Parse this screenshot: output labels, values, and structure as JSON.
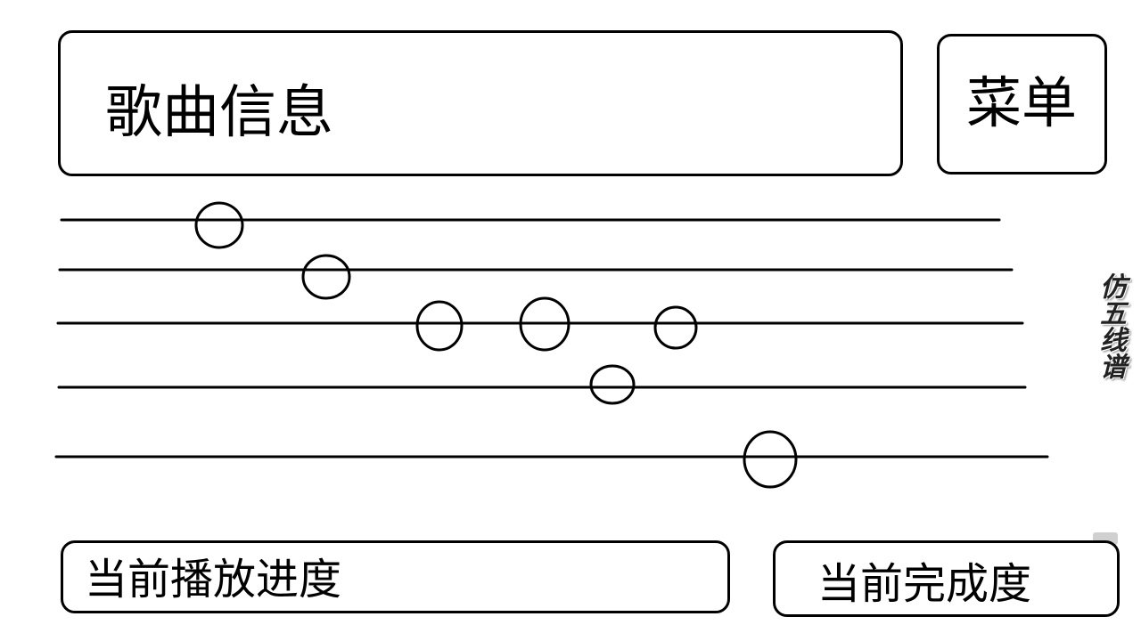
{
  "header": {
    "song_info_label": "歌曲信息",
    "menu_label": "菜单"
  },
  "staff": {
    "line_count": 5,
    "note_count": 7
  },
  "side_title": "仿五线谱",
  "footer": {
    "progress_label": "当前播放进度",
    "completion_label": "当前完成度"
  }
}
